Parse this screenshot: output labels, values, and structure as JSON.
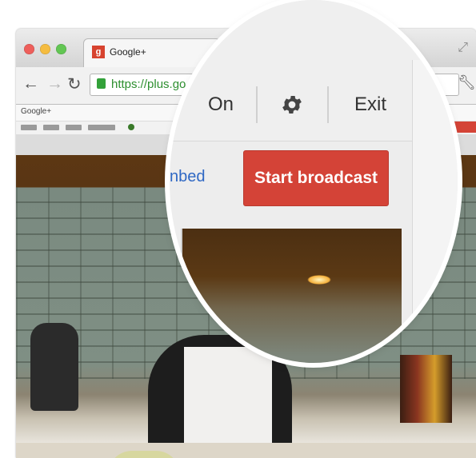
{
  "browser": {
    "tab_title": "Google+",
    "tab_favicon_letter": "g",
    "url": "https://plus.go"
  },
  "gplus_bar": {
    "logo": "Google+"
  },
  "magnified": {
    "on_label": "On",
    "exit_label": "Exit",
    "embed_label": "nbed",
    "start_broadcast_label": "Start broadcast"
  },
  "colors": {
    "start_button": "#d44337",
    "embed_link": "#2f68c4",
    "ssl_green": "#2d8f2f"
  },
  "icons": [
    "back-icon",
    "forward-icon",
    "reload-icon",
    "lock-icon",
    "settings-gear-icon",
    "wrench-icon",
    "fullscreen-icon"
  ]
}
